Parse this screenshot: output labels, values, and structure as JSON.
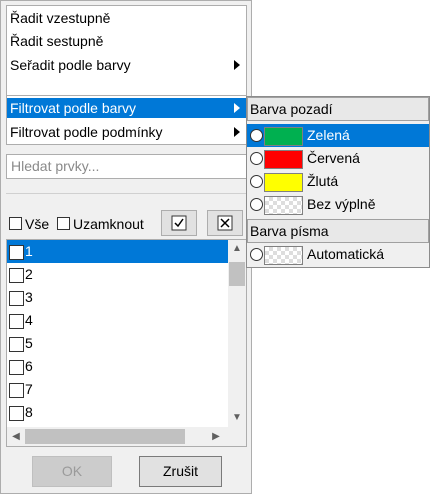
{
  "sort_menu": {
    "ascending": "Řadit vzestupně",
    "descending": "Řadit sestupně",
    "by_color": "Seřadit podle barvy"
  },
  "filter_menu": {
    "by_color": "Filtrovat podle barvy",
    "by_condition": "Filtrovat podle podmínky"
  },
  "search": {
    "placeholder": "Hledat prvky..."
  },
  "toolbar": {
    "all_label": "Vše",
    "lock_label": "Uzamknout"
  },
  "list": {
    "items": [
      "1",
      "2",
      "3",
      "4",
      "5",
      "6",
      "7",
      "8"
    ],
    "selected_index": 0
  },
  "buttons": {
    "ok": "OK",
    "cancel": "Zrušit"
  },
  "color_submenu": {
    "background_header": "Barva pozadí",
    "background_options": [
      {
        "name": "Zelená",
        "color": "#00b050"
      },
      {
        "name": "Červená",
        "color": "#ff0000"
      },
      {
        "name": "Žlutá",
        "color": "#ffff00"
      },
      {
        "name": "Bez výplně",
        "color": "none"
      }
    ],
    "font_header": "Barva písma",
    "font_options": [
      {
        "name": "Automatická",
        "color": "none"
      }
    ]
  },
  "colors": {
    "accent": "#0078d7"
  }
}
